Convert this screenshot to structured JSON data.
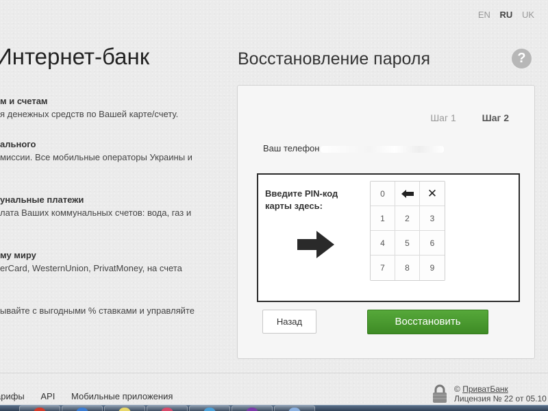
{
  "languages": [
    {
      "code": "EN",
      "active": false
    },
    {
      "code": "RU",
      "active": true
    },
    {
      "code": "UK",
      "active": false
    }
  ],
  "left": {
    "title": "Интернет-банк",
    "features": [
      {
        "title": "м и счетам",
        "desc": "я денежных средств по Вашей карте/счету."
      },
      {
        "title": "ального",
        "desc": "миссии. Все мобильные операторы Украины и"
      },
      {
        "title": "унальные платежи",
        "desc": "лата Ваших коммунальных счетов: вода, газ и"
      },
      {
        "title": "му миру",
        "desc": "erCard, WesternUnion, PrivatMoney, на счета"
      },
      {
        "title": "",
        "desc": "ывайте с выгодными % ставками и управляйте"
      }
    ]
  },
  "right": {
    "title": "Восстановление пароля",
    "help_label": "?",
    "steps": [
      "Шаг 1",
      "Шаг 2"
    ],
    "active_step": 2,
    "phone_label": "Ваш телефон",
    "pin_label": "Введите PIN-код карты здесь:",
    "keypad": [
      {
        "label": "0",
        "type": "digit"
      },
      {
        "label": "",
        "type": "backspace",
        "icon": "backspace-arrow-icon"
      },
      {
        "label": "✕",
        "type": "clear",
        "icon": "clear-x-icon"
      },
      {
        "label": "1",
        "type": "digit"
      },
      {
        "label": "2",
        "type": "digit"
      },
      {
        "label": "3",
        "type": "digit"
      },
      {
        "label": "4",
        "type": "digit"
      },
      {
        "label": "5",
        "type": "digit"
      },
      {
        "label": "6",
        "type": "digit"
      },
      {
        "label": "7",
        "type": "digit"
      },
      {
        "label": "8",
        "type": "digit"
      },
      {
        "label": "9",
        "type": "digit"
      }
    ],
    "back_button": "Назад",
    "restore_button": "Восстановить"
  },
  "footer": {
    "links": [
      "арифы",
      "API",
      "Мобильные приложения"
    ],
    "copyright_symbol": "©",
    "copyright_link": "ПриватБанк",
    "license": "Лицензия № 22 от 05.10"
  },
  "colors": {
    "accent_green": "#4a9a2e",
    "help_gray": "#b7b7b7"
  }
}
